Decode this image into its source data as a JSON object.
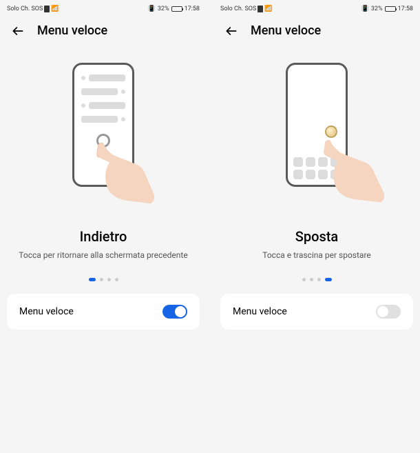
{
  "status": {
    "network": "Solo Ch. SOS",
    "battery_pct": "32%",
    "time": "17:58"
  },
  "header": {
    "title": "Menu veloce"
  },
  "left_screen": {
    "feature_title": "Indietro",
    "feature_desc": "Tocca per ritornare alla schermata precedente",
    "active_dot_index": 0,
    "toggle_label": "Menu veloce",
    "toggle_state": "on"
  },
  "right_screen": {
    "feature_title": "Sposta",
    "feature_desc": "Tocca e trascina per spostare",
    "active_dot_index": 3,
    "toggle_label": "Menu veloce",
    "toggle_state": "off"
  },
  "pagination": {
    "total_dots": 4
  }
}
